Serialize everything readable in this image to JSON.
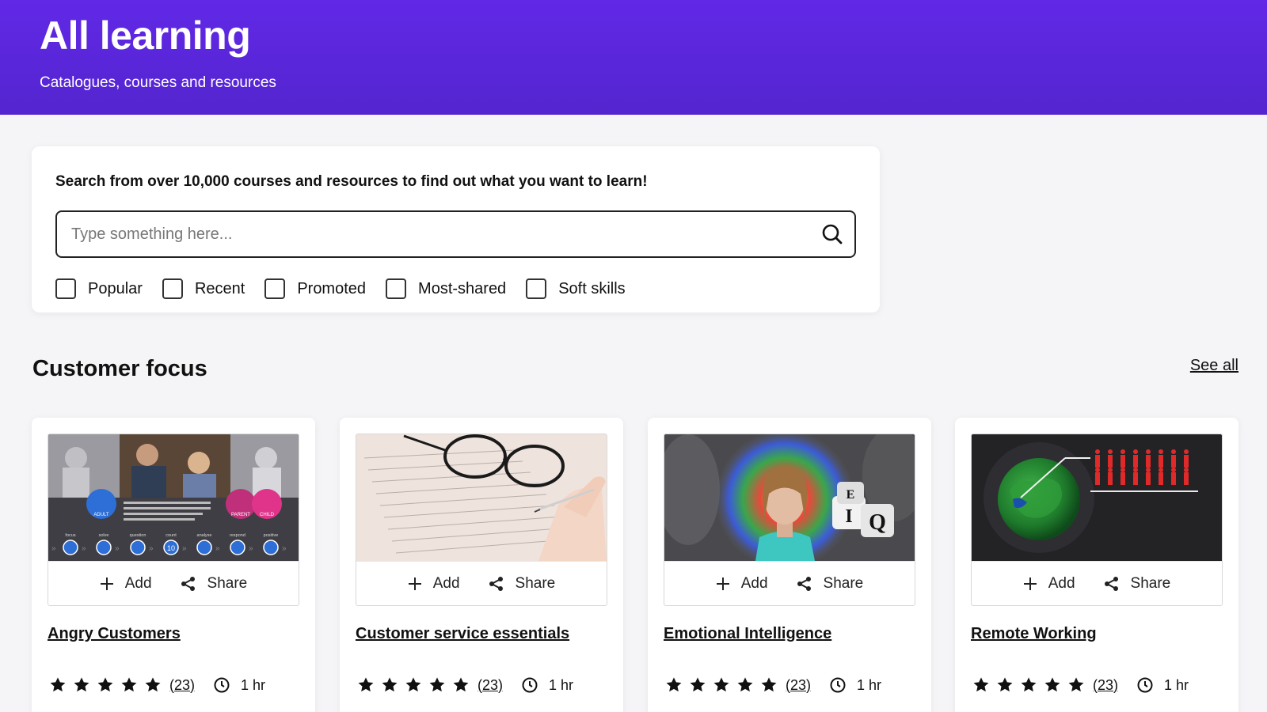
{
  "header": {
    "title": "All learning",
    "subtitle": "Catalogues, courses and resources"
  },
  "search": {
    "prompt": "Search from over 10,000 courses and resources to find out what you want to learn!",
    "placeholder": "Type something here...",
    "filters": [
      "Popular",
      "Recent",
      "Promoted",
      "Most-shared",
      "Soft skills"
    ]
  },
  "section": {
    "title": "Customer focus",
    "see_all": "See all"
  },
  "card_actions": {
    "add": "Add",
    "share": "Share"
  },
  "courses": [
    {
      "title": "Angry Customers",
      "rating": 5,
      "reviews": "(23)",
      "duration": "1 hr"
    },
    {
      "title": "Customer service essentials",
      "rating": 5,
      "reviews": "(23)",
      "duration": "1 hr"
    },
    {
      "title": "Emotional Intelligence",
      "rating": 5,
      "reviews": "(23)",
      "duration": "1 hr"
    },
    {
      "title": "Remote Working",
      "rating": 5,
      "reviews": "(23)",
      "duration": "1 hr"
    }
  ],
  "thumbnail_text": {
    "card1": {
      "badges": [
        "ADULT",
        "PARENT",
        "CHILD"
      ],
      "steps": [
        "focus",
        "solve",
        "question",
        "count",
        "analyse",
        "respond",
        "positive"
      ],
      "count_value": "10"
    },
    "card3": {
      "dice": [
        "E",
        "I",
        "Q"
      ]
    }
  },
  "colors": {
    "header": "#5a27dc",
    "background": "#f5f5f8",
    "card": "#ffffff",
    "accent_blue": "#2d6fd6",
    "accent_pink": "#e0348a"
  }
}
